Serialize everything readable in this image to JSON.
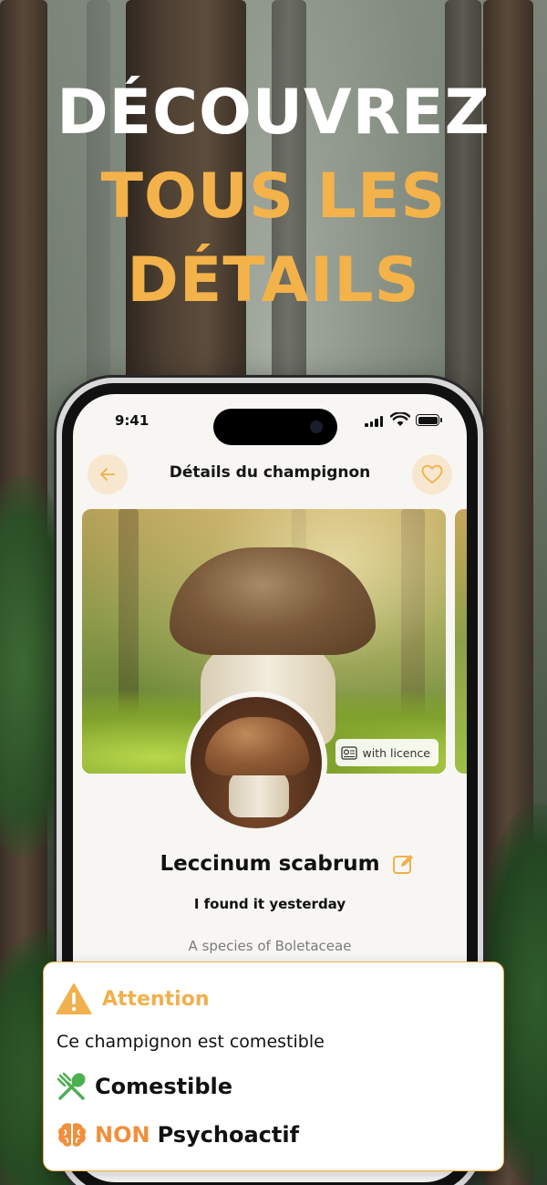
{
  "headline": {
    "line1": "DÉCOUVREZ",
    "line2": "TOUS LES",
    "line3": "DÉTAILS"
  },
  "status_bar": {
    "time": "9:41"
  },
  "nav": {
    "title": "Détails du champignon"
  },
  "photo": {
    "licence_label": "with licence"
  },
  "mushroom": {
    "species": "Leccinum scabrum",
    "note": "I found it yesterday",
    "family": "A species of Boletaceae"
  },
  "attention": {
    "title": "Attention",
    "text": "Ce champignon est comestible",
    "edible_label": "Comestible",
    "psychoactive_prefix": "NON",
    "psychoactive_label": "Psychoactif"
  },
  "colors": {
    "accent": "#f0b04c",
    "headline_yellow": "#f3b24a",
    "non_orange": "#f0903c",
    "edible_green": "#4caf50"
  },
  "icons": [
    "back-arrow-icon",
    "heart-icon",
    "licence-icon",
    "edit-icon",
    "warning-icon",
    "fork-spoon-icon",
    "brain-icon"
  ]
}
